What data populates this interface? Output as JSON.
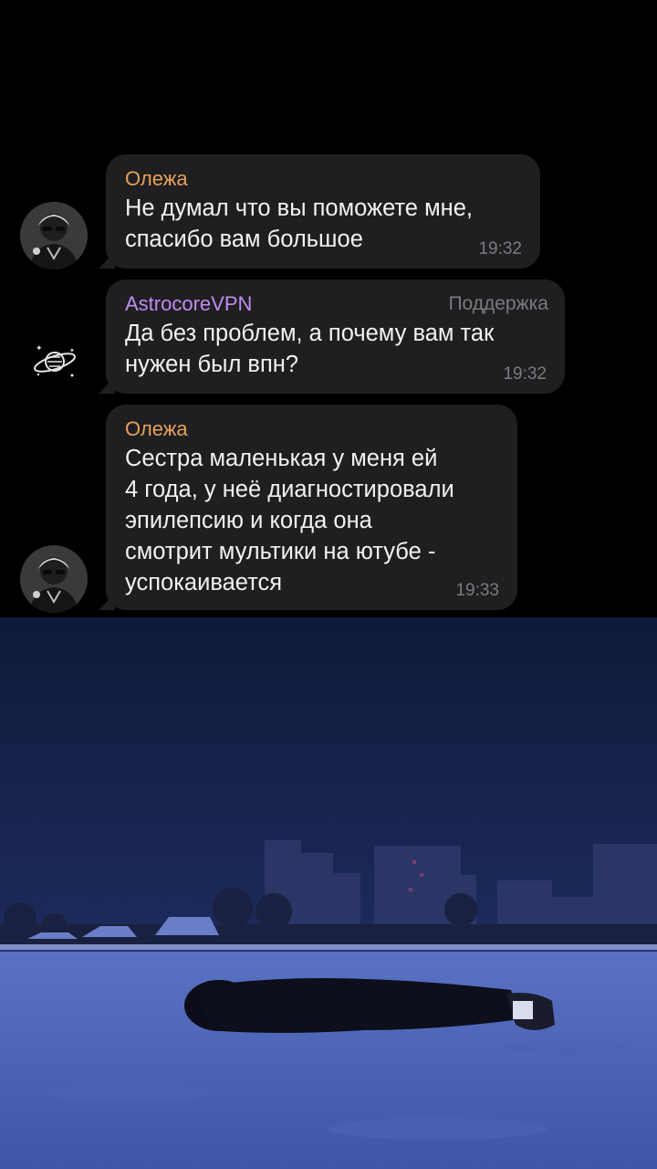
{
  "messages": [
    {
      "sender": "Олежа",
      "text": "Не думал что вы поможете мне,\nспасибо вам большое",
      "time": "19:32",
      "avatar": "person-avatar"
    },
    {
      "sender": "AstrocoreVPN",
      "role": "Поддержка",
      "text": "Да без проблем, а почему вам так\nнужен был впн?",
      "time": "19:32",
      "avatar": "planet-icon"
    },
    {
      "sender": "Олежа",
      "text": "Сестра маленькая у меня ей\n4 года, у неё диагностировали\nэпилепсию и когда она\nсмотрит мультики на ютубе -\nуспокаивается",
      "time": "19:33",
      "avatar": "person-avatar"
    }
  ],
  "colors": {
    "bubble": "#1f1f21",
    "user_name": "#e8a15a",
    "support_name": "#c08cf2",
    "meta": "#7b7b7f",
    "text": "#f2f2f2"
  }
}
